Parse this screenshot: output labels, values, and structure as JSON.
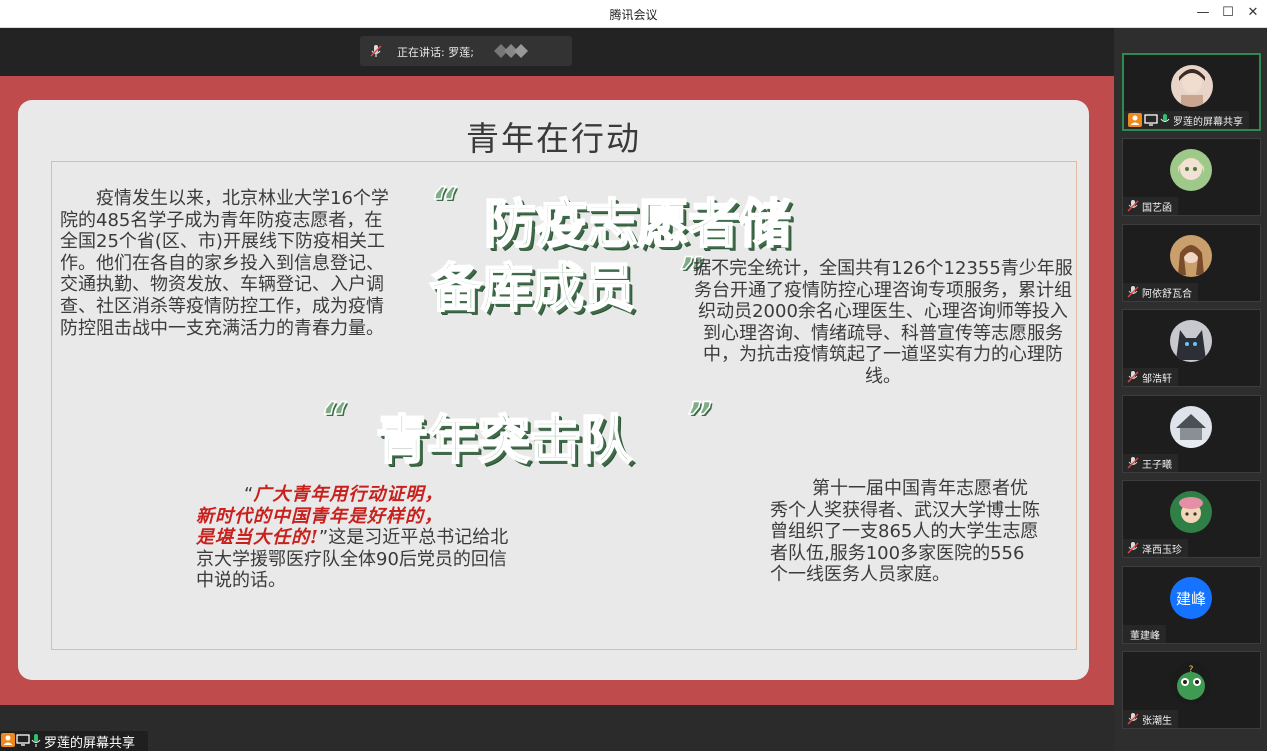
{
  "window": {
    "title": "腾讯会议"
  },
  "speaking": {
    "label": "正在讲话: 罗莲;"
  },
  "slide": {
    "title": "青年在行动",
    "para1": "疫情发生以来，北京林业大学16个学院的485名学子成为青年防疫志愿者，在全国25个省(区、市)开展线下防疫相关工作。他们在各自的家乡投入到信息登记、交通执勤、物资发放、车辆登记、入户调查、社区消杀等疫情防控工作，成为疫情防控阻击战中一支充满活力的青春力量。",
    "heading1_line1": "防疫志愿者储",
    "heading1_line2": "备库成员",
    "para2": "据不完全统计，全国共有126个12355青少年服务台开通了疫情防控心理咨询专项服务，累计组织动员2000余名心理医生、心理咨询师等投入到心理咨询、情绪疏导、科普宣传等志愿服务中，为抗击疫情筑起了一道坚实有力的心理防线。",
    "heading2": "青年突击队",
    "quote_open": "“",
    "quote_line1": "广大青年用行动证明，",
    "quote_line2": "新时代的中国青年是好样的，",
    "quote_line3": "是堪当大任的!",
    "quote_close": "”",
    "para3_rest": "这是习近平总书记给北京大学援鄂医疗队全体90后党员的回信中说的话。",
    "para4": "第十一届中国青年志愿者优秀个人奖获得者、武汉大学博士陈曾组织了一支865人的大学生志愿者队伍,服务100多家医院的556个一线医务人员家庭。",
    "mark_open": "“",
    "mark_close": "”"
  },
  "share_label": "罗莲的屏幕共享",
  "participants": [
    {
      "name": "罗莲的屏幕共享",
      "avatar_color": "#d8b9a6"
    },
    {
      "name": "国艺函",
      "avatar_color": "#9ec98a"
    },
    {
      "name": "阿依舒瓦合",
      "avatar_color": "#a3784f"
    },
    {
      "name": "邹浩轩",
      "avatar_color": "#6a6f7a"
    },
    {
      "name": "王子曦",
      "avatar_color": "#c9cfd6"
    },
    {
      "name": "泽西玉珍",
      "avatar_color": "#2f7f46"
    },
    {
      "name": "董建峰",
      "avatar_text": "建峰",
      "avatar_color": "#1673ff"
    },
    {
      "name": "张潮生",
      "avatar_color": "#3f9a52"
    }
  ],
  "colors": {
    "accent_green": "#7fae86",
    "slide_red": "#c04b4d",
    "quote_red": "#c8211d",
    "active_border": "#2d8b52"
  }
}
